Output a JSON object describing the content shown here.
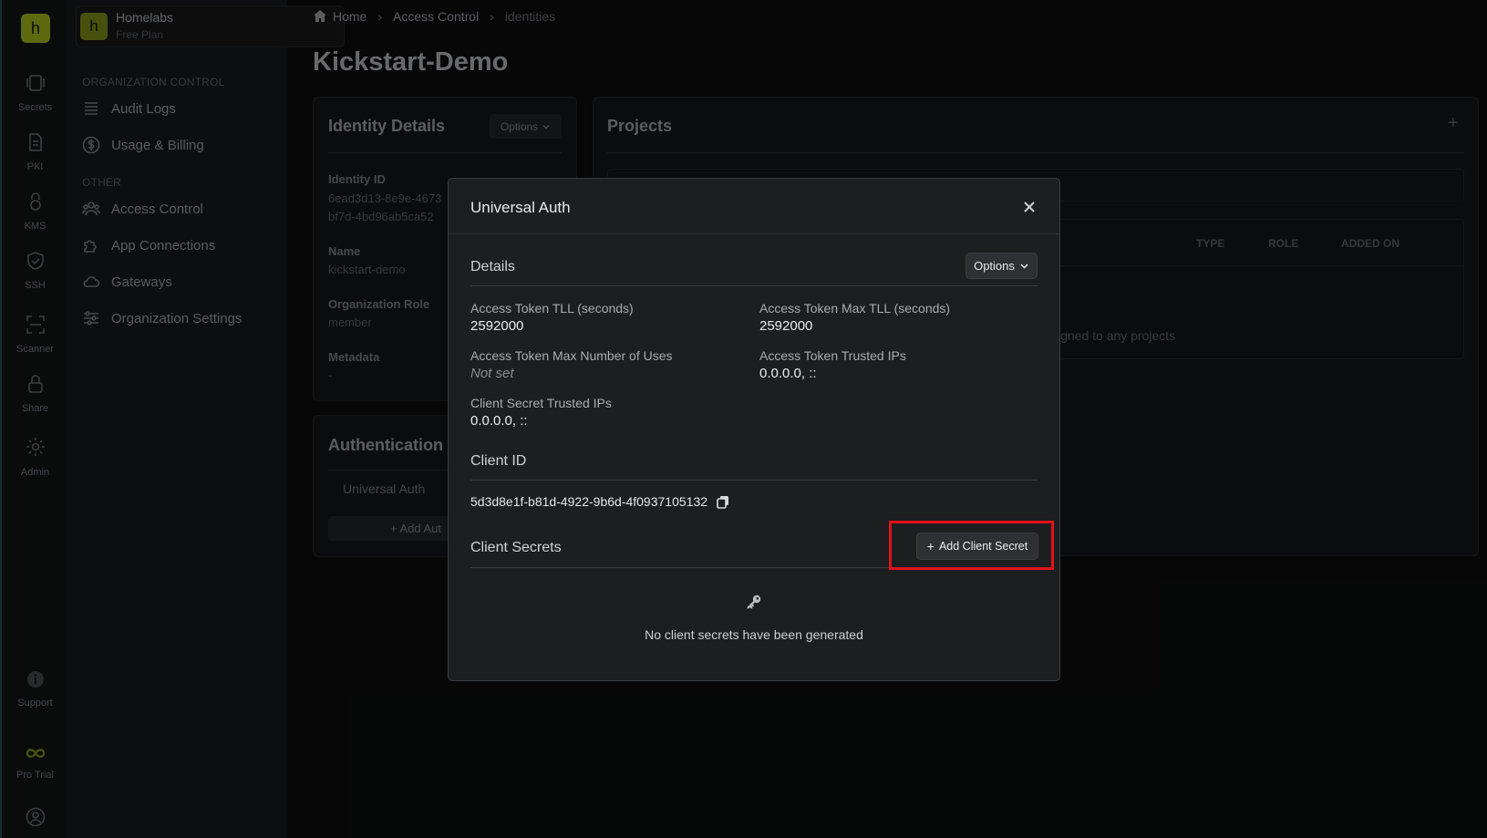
{
  "rail": {
    "logo_letter": "h",
    "items": [
      {
        "label": "Secrets"
      },
      {
        "label": "PKI"
      },
      {
        "label": "KMS"
      },
      {
        "label": "SSH"
      },
      {
        "label": "Scanner"
      },
      {
        "label": "Share"
      },
      {
        "label": "Admin"
      }
    ],
    "support_label": "Support",
    "trial_label": "Pro Trial"
  },
  "sidebar": {
    "org_letter": "h",
    "org_name": "Homelabs",
    "org_plan": "Free Plan",
    "section_org": "ORGANIZATION CONTROL",
    "section_other": "OTHER",
    "items": [
      {
        "label": "Audit Logs"
      },
      {
        "label": "Usage & Billing"
      },
      {
        "label": "Access Control"
      },
      {
        "label": "App Connections"
      },
      {
        "label": "Gateways"
      },
      {
        "label": "Organization Settings"
      }
    ]
  },
  "breadcrumb": {
    "home": "Home",
    "access_control": "Access Control",
    "current": "identities"
  },
  "page": {
    "title": "Kickstart-Demo"
  },
  "identity_details": {
    "title": "Identity Details",
    "options_label": "Options",
    "id_label": "Identity ID",
    "id_value_line1": "6ead3d13-8e9e-4673",
    "id_value_line2": "bf7d-4bd96ab5ca52",
    "name_label": "Name",
    "name_value": "kickstart-demo",
    "role_label": "Organization Role",
    "role_value": "member",
    "metadata_label": "Metadata",
    "metadata_value": "-"
  },
  "authentication": {
    "title": "Authentication",
    "method": "Universal Auth",
    "add_label": "+ Add Aut"
  },
  "projects": {
    "title": "Projects",
    "col_type": "TYPE",
    "col_role": "ROLE",
    "col_added": "ADDED ON",
    "empty_fragment": "signed to any projects"
  },
  "modal": {
    "title": "Universal Auth",
    "details_title": "Details",
    "options_label": "Options",
    "fields": {
      "access_token_ttl_label": "Access Token TLL (seconds)",
      "access_token_ttl_value": "2592000",
      "access_token_max_ttl_label": "Access Token Max TLL (seconds)",
      "access_token_max_ttl_value": "2592000",
      "max_uses_label": "Access Token Max Number of Uses",
      "max_uses_value": "Not set",
      "trusted_ips_label": "Access Token Trusted IPs",
      "trusted_ips_value": "0.0.0.0, ::",
      "client_secret_ips_label": "Client Secret Trusted IPs",
      "client_secret_ips_value": "0.0.0.0, ::"
    },
    "client_id_title": "Client ID",
    "client_id_value": "5d3d8e1f-b81d-4922-9b6d-4f0937105132",
    "client_secrets_title": "Client Secrets",
    "add_secret_label": "Add Client Secret",
    "empty_text": "No client secrets have been generated"
  },
  "colors": {
    "accent_olive": "#8fa31a",
    "highlight_red": "#e0121a",
    "modal_bg": "#1d1e20"
  }
}
